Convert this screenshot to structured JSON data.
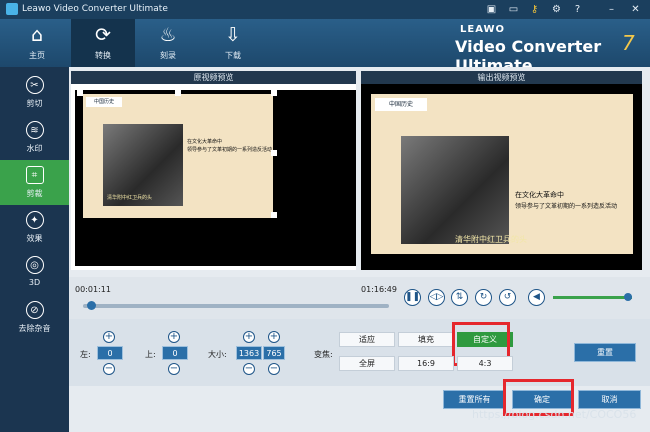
{
  "window": {
    "title": "Leawo Video Converter Ultimate"
  },
  "titlebar_icons": [
    "film-icon",
    "chat-icon",
    "key-icon",
    "gear-icon",
    "help-icon",
    "minimize-icon",
    "close-icon"
  ],
  "topnav": {
    "items": [
      {
        "label": "主页",
        "icon": "home-icon"
      },
      {
        "label": "转换",
        "icon": "convert-icon",
        "active": true
      },
      {
        "label": "刻录",
        "icon": "burn-icon"
      },
      {
        "label": "下载",
        "icon": "download-icon"
      }
    ],
    "brand_small": "LEAWO",
    "brand_big": "Video Converter Ultimate",
    "brand_version": "7"
  },
  "sidebar": {
    "items": [
      {
        "label": "剪切",
        "icon": "scissors-icon"
      },
      {
        "label": "水印",
        "icon": "watermark-icon"
      },
      {
        "label": "剪裁",
        "icon": "crop-icon",
        "active": true
      },
      {
        "label": "效果",
        "icon": "effect-icon"
      },
      {
        "label": "3D",
        "icon": "3d-icon"
      },
      {
        "label": "去除杂音",
        "icon": "denoise-icon"
      }
    ]
  },
  "preview": {
    "original_label": "原视频预览",
    "output_label": "输出视频预览",
    "logo_text": "中国历史",
    "logo_sub": "zhongguolishi",
    "caption_line1": "在文化大革命中",
    "caption_line2": "领导参与了文革初期的一系列造反活动",
    "subtitle": "清华附中红卫兵的头"
  },
  "timeline": {
    "current_time": "00:01:11",
    "total_time": "01:16:49",
    "progress": 0.02,
    "volume": 0.95
  },
  "crop": {
    "left_label": "左:",
    "left_value": "0",
    "top_label": "上:",
    "top_value": "0",
    "size_label": "大小:",
    "width_value": "1363",
    "height_value": "765",
    "zoom_label": "变焦:",
    "ratios": [
      {
        "label": "适应"
      },
      {
        "label": "填充"
      },
      {
        "label": "自定义",
        "active": true
      },
      {
        "label": "全屏"
      },
      {
        "label": "16:9"
      },
      {
        "label": "4:3"
      }
    ],
    "reset_label": "重置"
  },
  "footer": {
    "reset_all_label": "重置所有",
    "confirm_label": "确定",
    "cancel_label": "取消",
    "watermark": "https://blog.csdn.net/COCO56"
  },
  "colors": {
    "accent_green": "#3aa24b",
    "accent_blue": "#2b6fa8",
    "highlight_red": "#e5272d"
  }
}
